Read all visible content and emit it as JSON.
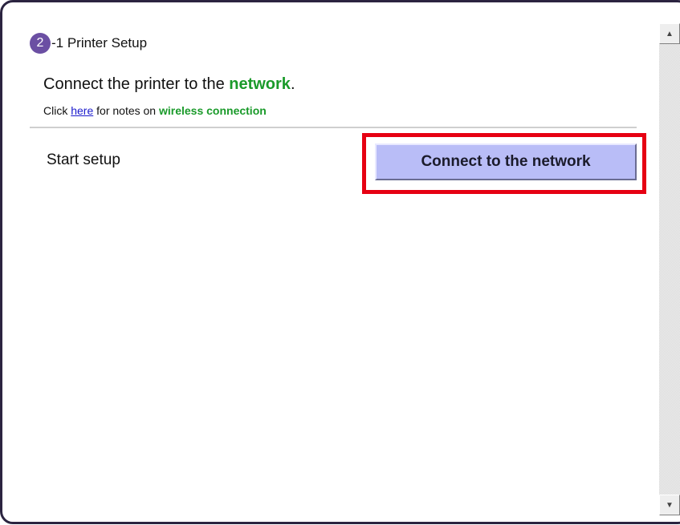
{
  "header": {
    "step_number": "2",
    "step_title": "-1 Printer Setup"
  },
  "headline": {
    "prefix": "Connect the printer to the ",
    "emphasis": "network",
    "suffix": "."
  },
  "note": {
    "prefix": "Click ",
    "link": "here",
    "middle": " for notes on ",
    "emphasis": "wireless connection"
  },
  "setup": {
    "label": "Start setup",
    "button_label": "Connect to the network"
  },
  "scrollbar": {
    "up_icon": "▲",
    "down_icon": "▼"
  },
  "colors": {
    "badge": "#6b4fa3",
    "emphasis_green": "#1a9a2a",
    "link_blue": "#1a1acc",
    "highlight_red": "#e60012",
    "button_fill": "#b9bdf7"
  }
}
